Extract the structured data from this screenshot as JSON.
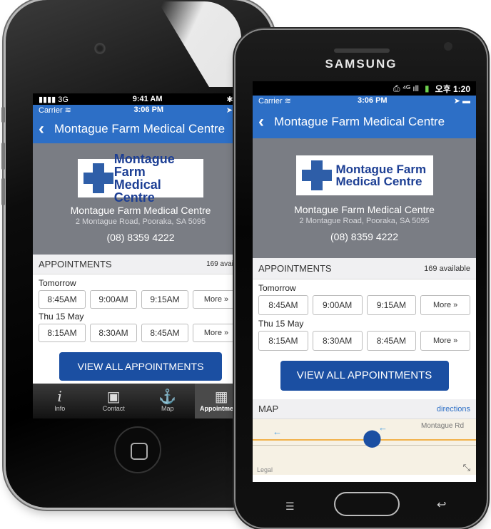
{
  "iphone": {
    "device_status": {
      "signal": "3G",
      "time": "9:41 AM"
    },
    "app_status": {
      "carrier": "Carrier",
      "time": "3:06 PM"
    },
    "nav_title": "Montague Farm Medical Centre",
    "tabs": [
      {
        "label": "Info",
        "icon": "info-icon"
      },
      {
        "label": "Contact",
        "icon": "contact-icon"
      },
      {
        "label": "Map",
        "icon": "map-icon"
      },
      {
        "label": "Appointments",
        "icon": "calendar-icon"
      }
    ]
  },
  "samsung": {
    "brand": "SAMSUNG",
    "android_time": "오후 1:20",
    "app_status": {
      "carrier": "Carrier",
      "time": "3:06 PM"
    },
    "nav_title": "Montague Farm Medical Centre",
    "map": {
      "title": "MAP",
      "directions": "directions",
      "road_label": "Montague Rd",
      "legal": "Legal"
    }
  },
  "clinic": {
    "logo_line1": "Montague Farm",
    "logo_line2": "Medical Centre",
    "name": "Montague Farm Medical Centre",
    "address": "2 Montague Road, Pooraka, SA 5095",
    "phone": "(08) 8359 4222"
  },
  "appointments": {
    "title": "APPOINTMENTS",
    "available": "169 available",
    "days": [
      {
        "label": "Tomorrow",
        "slots": [
          "8:45AM",
          "9:00AM",
          "9:15AM"
        ],
        "more": "More »"
      },
      {
        "label": "Thu 15 May",
        "slots": [
          "8:15AM",
          "8:30AM",
          "8:45AM"
        ],
        "more": "More »"
      }
    ],
    "view_all": "VIEW ALL APPOINTMENTS"
  },
  "colors": {
    "nav_blue": "#2d6fc6",
    "hero_gray": "#7a7d84",
    "button_blue": "#1b4fa2"
  }
}
